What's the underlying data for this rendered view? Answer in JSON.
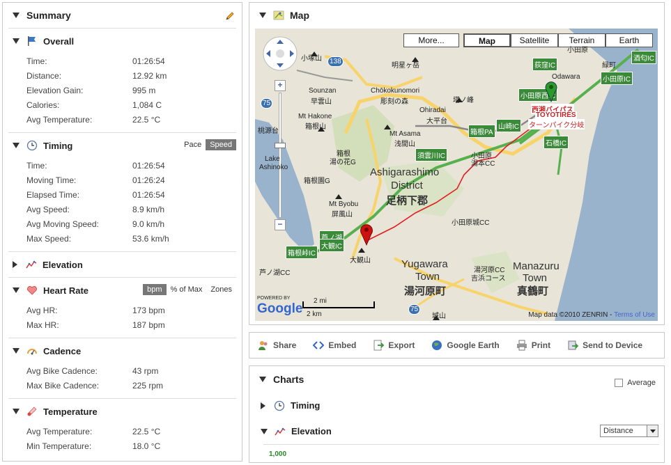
{
  "summary": {
    "title": "Summary",
    "overall": {
      "title": "Overall",
      "rows": [
        {
          "k": "Time:",
          "v": "01:26:54"
        },
        {
          "k": "Distance:",
          "v": "12.92 km"
        },
        {
          "k": "Elevation Gain:",
          "v": "995 m"
        },
        {
          "k": "Calories:",
          "v": "1,084 C"
        },
        {
          "k": "Avg Temperature:",
          "v": "22.5 °C"
        }
      ]
    },
    "timing": {
      "title": "Timing",
      "toggle_pace": "Pace",
      "toggle_speed": "Speed",
      "rows": [
        {
          "k": "Time:",
          "v": "01:26:54"
        },
        {
          "k": "Moving Time:",
          "v": "01:26:24"
        },
        {
          "k": "Elapsed Time:",
          "v": "01:26:54"
        },
        {
          "k": "Avg Speed:",
          "v": "8.9 km/h"
        },
        {
          "k": "Avg Moving Speed:",
          "v": "9.0 km/h"
        },
        {
          "k": "Max Speed:",
          "v": "53.6 km/h"
        }
      ]
    },
    "elevation": {
      "title": "Elevation"
    },
    "heart_rate": {
      "title": "Heart Rate",
      "toggle_bpm": "bpm",
      "toggle_max": "% of Max",
      "toggle_zones": "Zones",
      "rows": [
        {
          "k": "Avg HR:",
          "v": "173 bpm"
        },
        {
          "k": "Max HR:",
          "v": "187 bpm"
        }
      ]
    },
    "cadence": {
      "title": "Cadence",
      "rows": [
        {
          "k": "Avg Bike Cadence:",
          "v": "43 rpm"
        },
        {
          "k": "Max Bike Cadence:",
          "v": "225 rpm"
        }
      ]
    },
    "temperature": {
      "title": "Temperature",
      "rows": [
        {
          "k": "Avg Temperature:",
          "v": "22.5 °C"
        },
        {
          "k": "Min Temperature:",
          "v": "18.0 °C"
        }
      ]
    }
  },
  "map": {
    "title": "Map",
    "buttons": {
      "more": "More...",
      "map": "Map",
      "satellite": "Satellite",
      "terrain": "Terrain",
      "earth": "Earth"
    },
    "places": {
      "district": "Ashigarashimo",
      "district2": "District",
      "district_jp": "足柄下郡",
      "yugawara": "Yugawara",
      "yugawara_town": "Town",
      "yugawara_jp": "湯河原町",
      "manazuru": "Manazuru",
      "manazuru_town": "Town",
      "manazuru_jp": "真鶴町",
      "mt_hakone": "Mt Hakone",
      "mt_hakone_jp": "箱根山",
      "mt_asama": "Mt Asama",
      "mt_asama_jp": "浅間山",
      "mt_byobu": "Mt Byobu",
      "mt_byobu_jp": "屏風山",
      "sounzan": "Sounzan",
      "sounzan_jp": "早雲山",
      "chokoku": "Chōkokunomori",
      "chokoku_jp": "彫刻の森",
      "ohiradai": "Ohiradai",
      "ohiradai_jp": "大平台",
      "odawara": "Odawara",
      "odawara_jp": "小田原",
      "kozukayama": "小塚山",
      "myojogatake": "明星ヶ岳",
      "tonomine": "塔ノ峰",
      "hakone_kowakien": "箱根",
      "hakone_kowakien2": "湯の花G",
      "hakone_en": "箱根園G",
      "yumoto": "小田原",
      "yumoto2": "湯本CC",
      "odawara_castle_cc": "小田原城CC",
      "yugawara_cc": "湯河原CC",
      "yoshihama": "吉浜コース",
      "shiroyama": "城山",
      "taikanzan": "大観山",
      "ashinoko": "芦ノ湖CC",
      "lake_ashinoko": "Lake",
      "lake_ashinoko2": "Ashinoko",
      "momiji": "桃源台",
      "toyotires": "西湘バイパス",
      "toyotires2": "TOYOTIRES",
      "toyotires3": "ターンパイク分岐"
    },
    "signs": {
      "ogikubo": "荻窪IC",
      "odawara_nishi": "小田原西IC",
      "odawara_ic": "小田原IC",
      "sakawa": "酒匂IC",
      "hakone_pa": "箱根PA",
      "yamazaki": "山崎IC",
      "suzukawa": "須雲川IC",
      "ishibashi": "石橋IC",
      "ashinoko_ic": "芦ノ湖",
      "ashinoko_ic2": "大観IC",
      "hakone_toge": "箱根峠IC",
      "route138": "138",
      "route75a": "75",
      "route75b": "75",
      "midori": "緑町"
    },
    "scale_mi": "2 mi",
    "scale_km": "2 km",
    "powered": "POWERED BY",
    "google": "Google",
    "copyright": "Map data ©2010 ZENRIN - ",
    "terms": "Terms of Use",
    "route_color": "#e02020",
    "start_color": "#2a9a2a",
    "end_color": "#cc1111"
  },
  "share": {
    "share": "Share",
    "embed": "Embed",
    "export": "Export",
    "google_earth": "Google Earth",
    "print": "Print",
    "send": "Send to Device"
  },
  "charts": {
    "title": "Charts",
    "average": "Average",
    "timing": "Timing",
    "elevation": "Elevation",
    "select_value": "Distance",
    "y_top": "1,000"
  }
}
